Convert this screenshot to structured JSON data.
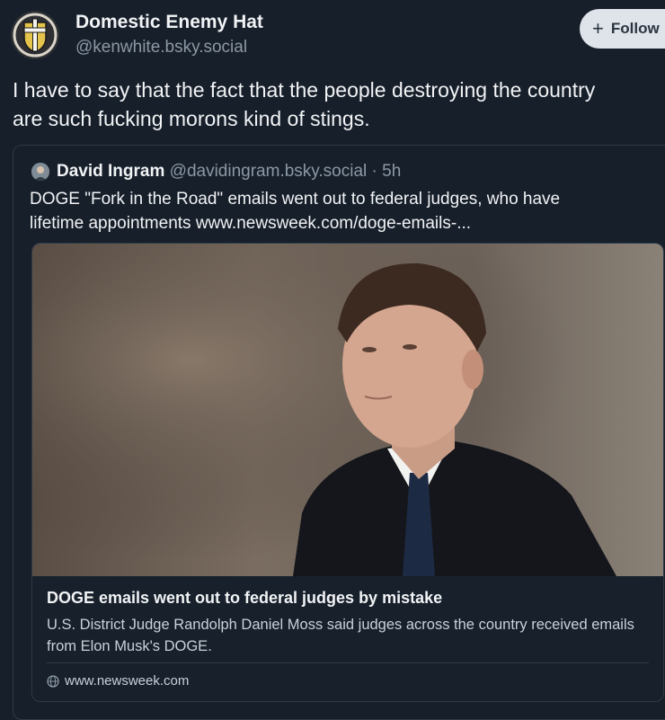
{
  "post": {
    "author_name": "Domestic Enemy Hat",
    "author_handle": "@kenwhite.bsky.social",
    "follow_label": "Follow",
    "text": "I have to say that the fact that the people destroying the country\nare such fucking morons kind of stings."
  },
  "quote": {
    "author_name": "David Ingram",
    "author_handle": "@davidingram.bsky.social",
    "separator": "·",
    "time": "5h",
    "text": "DOGE \"Fork in the Road\" emails went out to federal judges, who have\nlifetime appointments www.newsweek.com/doge-emails-..."
  },
  "embed": {
    "title": "DOGE emails went out to federal judges by mistake",
    "description": "U.S. District Judge Randolph Daniel Moss said judges across the country received emails from Elon Musk's DOGE.",
    "domain": "www.newsweek.com"
  },
  "icons": {
    "follow": "plus-icon",
    "domain": "globe-icon"
  },
  "colors": {
    "background": "#171f2a",
    "follow_button": "#dfe4ea",
    "secondary_text": "#8b98a5",
    "border": "#2e3a48"
  }
}
